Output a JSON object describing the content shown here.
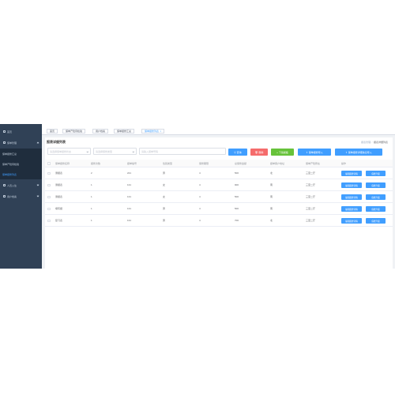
{
  "sidebar": {
    "items": [
      {
        "label": "首页"
      },
      {
        "label": "保单管理"
      },
      {
        "label": "保单报修汇总"
      },
      {
        "label": "保单产险待检验"
      },
      {
        "label": "保单报修列表"
      },
      {
        "label": "人员入住"
      },
      {
        "label": "用户档案"
      }
    ]
  },
  "tabs": [
    {
      "label": "首页"
    },
    {
      "label": "保单产险待检验"
    },
    {
      "label": "用户档案"
    },
    {
      "label": "保单报修汇总"
    },
    {
      "label": "保单报修列表"
    }
  ],
  "active_tab_close": "×",
  "page": {
    "title": "报表详细列表",
    "breadcrumb": [
      "报表管理",
      "报表详细列表"
    ]
  },
  "filters": {
    "select1_placeholder": "请选择保单报修状态",
    "select2_placeholder": "请选择保修类型",
    "search_placeholder": "请输入保单号码"
  },
  "buttons": {
    "search": "查询",
    "delete": "删除",
    "add": "下载模板",
    "import": "保单报修导入",
    "import_detail": "保单报修详细信息导入",
    "search_glyph": "⚲",
    "delete_glyph": "🗑",
    "add_glyph": "+",
    "import_glyph": "⇪"
  },
  "table": {
    "headers": [
      "保单报修名称",
      "报修次数",
      "报单编号",
      "性别类型",
      "保修期限",
      "总保修金额",
      "报单客户地址",
      "保单产险所在",
      "操作"
    ],
    "rows": [
      [
        "测报表",
        "2",
        "221",
        "男",
        "4",
        "500",
        "北",
        "三室二厅"
      ],
      [
        "测报表",
        "1",
        "131",
        "女",
        "4",
        "900",
        "南",
        "三室二厅"
      ],
      [
        "测报表",
        "1",
        "131",
        "女",
        "4",
        "500",
        "南",
        "三室二厅"
      ],
      [
        "填写报",
        "1",
        "131",
        "男",
        "4",
        "500",
        "南",
        "三室二厅"
      ],
      [
        "复习表",
        "1",
        "131",
        "男",
        "4",
        "700",
        "北",
        "三室二厅"
      ]
    ],
    "op_edit": "编辑报修详情",
    "op_view": "保修升级"
  },
  "colors": {
    "sidebar_bg": "#304156",
    "primary": "#409eff",
    "danger": "#f56c6c",
    "success": "#67c23a"
  }
}
